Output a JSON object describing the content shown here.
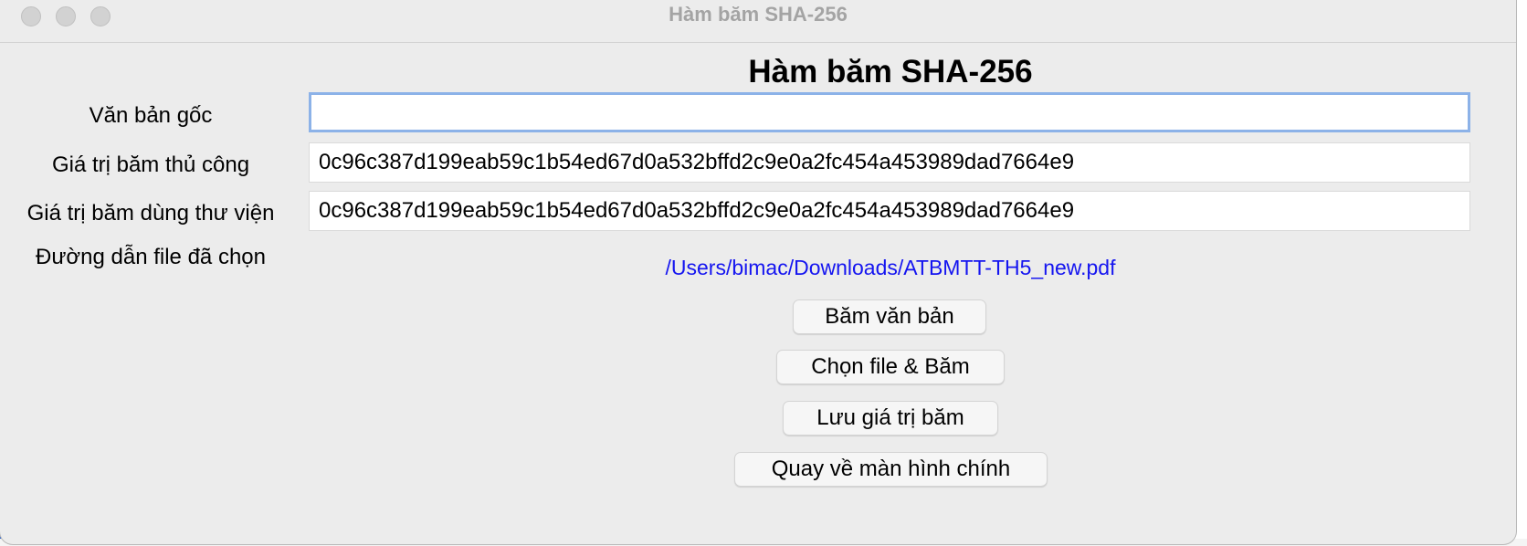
{
  "window": {
    "title": "Hàm băm SHA-256"
  },
  "form": {
    "heading": "Hàm băm SHA-256",
    "plaintext_label": "Văn bản gốc",
    "plaintext_value": "",
    "manual_hash_label": "Giá trị băm thủ công",
    "manual_hash_value": "0c96c387d199eab59c1b54ed67d0a532bffd2c9e0a2fc454a453989dad7664e9",
    "library_hash_label": "Giá trị băm dùng thư viện",
    "library_hash_value": "0c96c387d199eab59c1b54ed67d0a532bffd2c9e0a2fc454a453989dad7664e9",
    "file_path_label": "Đường dẫn file đã chọn",
    "file_path_value": "/Users/bimac/Downloads/ATBMTT-TH5_new.pdf"
  },
  "buttons": {
    "hash_text": "Băm văn bản",
    "choose_file_hash": "Chọn file & Băm",
    "save_hash": "Lưu giá trị băm",
    "back_home": "Quay về màn hình chính"
  },
  "colors": {
    "window_bg": "#ececec",
    "link": "#1515f0",
    "focus_ring": "#8cb2e8"
  }
}
